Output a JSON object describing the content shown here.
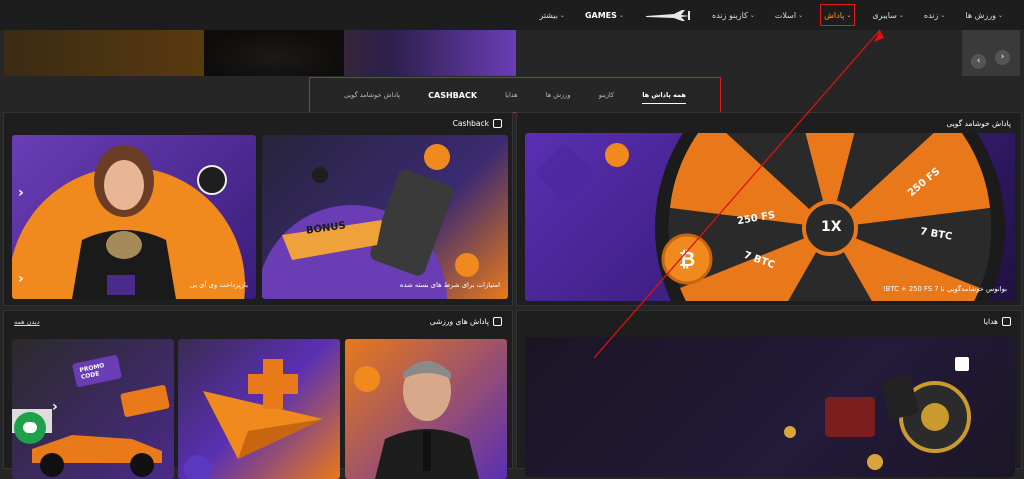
{
  "nav": {
    "items": [
      {
        "label": "ورزش ها",
        "chevron": true
      },
      {
        "label": "زنده",
        "chevron": true
      },
      {
        "label": "سایبری",
        "chevron": true
      },
      {
        "label": "پاداش",
        "chevron": true,
        "active": true
      },
      {
        "label": "اسلات",
        "chevron": true
      },
      {
        "label": "کازینو زنده",
        "chevron": true
      },
      {
        "label": "GAMES",
        "chevron": true
      },
      {
        "label": "بیشتر",
        "chevron": true
      }
    ],
    "logo_icon": "aviator-plane-icon"
  },
  "banner": {
    "prev_icon": "chevron-left-icon",
    "next_icon": "chevron-right-icon"
  },
  "tabs": [
    {
      "label": "همه پاداش ها",
      "active": true
    },
    {
      "label": "کازینو"
    },
    {
      "label": "ورزش ها"
    },
    {
      "label": "هدایا"
    },
    {
      "label": "CASHBACK"
    },
    {
      "label": "پاداش خوشامد گویی"
    }
  ],
  "welcome": {
    "title": "پاداش خوشامد گویی",
    "card_caption": "!BTC + 250 FS 7 بوانوس خوشامدگویی تا",
    "wheel_labels": [
      "250 FS",
      "7 BTC",
      "1X",
      "250 FS",
      "7 BTC"
    ]
  },
  "cashback": {
    "title": "Cashback",
    "cards": [
      {
        "caption": "امتیازات برای شرط های بسته شده",
        "badge": "BONUS"
      },
      {
        "caption": "بازپرداخت وی آی پی"
      }
    ]
  },
  "gifts": {
    "title": "هدایا"
  },
  "sports": {
    "title": "پاداش های ورزشی",
    "see_all": "دیدن همه",
    "promo": "PROMO CODE"
  },
  "colors": {
    "accent": "#ff8a1a",
    "purple": "#6a3db5",
    "highlight_border": "#e01b1b",
    "chat": "#1fa04a"
  }
}
